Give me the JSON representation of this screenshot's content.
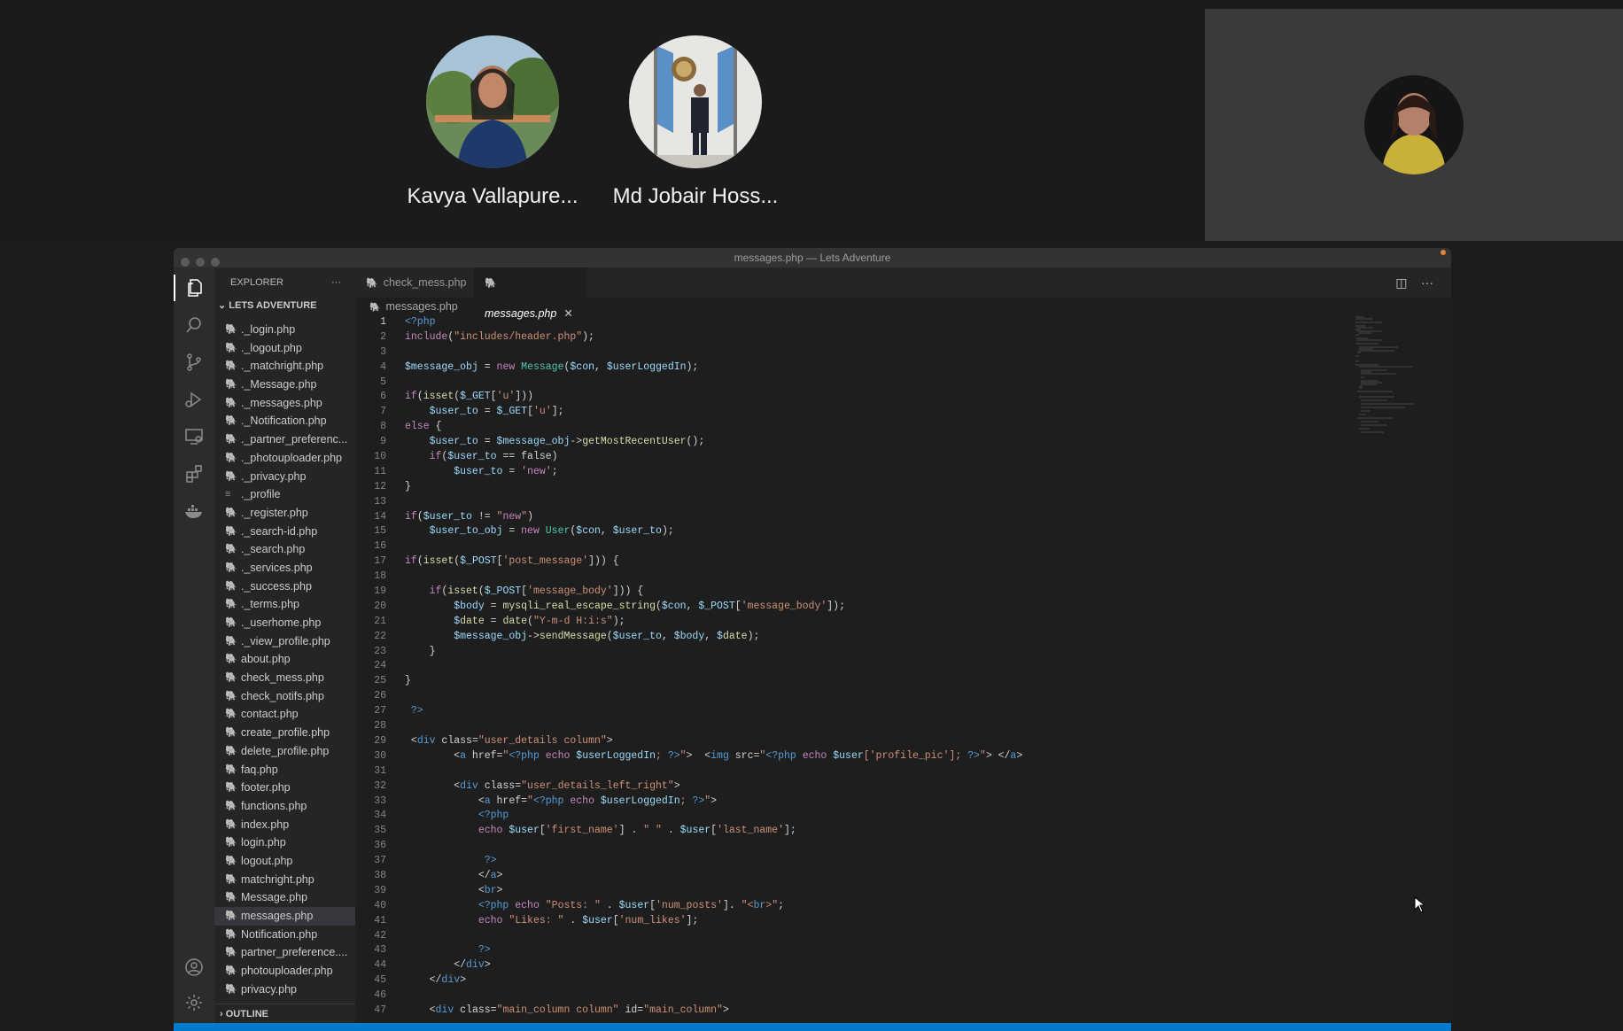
{
  "meeting": {
    "participants": [
      {
        "name": "Kavya Vallapure..."
      },
      {
        "name": "Md Jobair Hoss..."
      }
    ]
  },
  "window": {
    "title": "messages.php — Lets Adventure"
  },
  "sidebar": {
    "title": "EXPLORER",
    "more_label": "···",
    "folder": "LETS ADVENTURE",
    "files": [
      {
        "name": "._login.php",
        "icon": "php-icon"
      },
      {
        "name": "._logout.php",
        "icon": "php-icon"
      },
      {
        "name": "._matchright.php",
        "icon": "php-icon"
      },
      {
        "name": "._Message.php",
        "icon": "php-icon"
      },
      {
        "name": "._messages.php",
        "icon": "php-icon"
      },
      {
        "name": "._Notification.php",
        "icon": "php-icon"
      },
      {
        "name": "._partner_preferenc...",
        "icon": "php-icon"
      },
      {
        "name": "._photouploader.php",
        "icon": "php-icon"
      },
      {
        "name": "._privacy.php",
        "icon": "php-icon"
      },
      {
        "name": "._profile",
        "icon": "file-icon"
      },
      {
        "name": "._register.php",
        "icon": "php-icon"
      },
      {
        "name": "._search-id.php",
        "icon": "php-icon"
      },
      {
        "name": "._search.php",
        "icon": "php-icon"
      },
      {
        "name": "._services.php",
        "icon": "php-icon"
      },
      {
        "name": "._success.php",
        "icon": "php-icon"
      },
      {
        "name": "._terms.php",
        "icon": "php-icon"
      },
      {
        "name": "._userhome.php",
        "icon": "php-icon"
      },
      {
        "name": "._view_profile.php",
        "icon": "php-icon"
      },
      {
        "name": "about.php",
        "icon": "php-icon"
      },
      {
        "name": "check_mess.php",
        "icon": "php-icon"
      },
      {
        "name": "check_notifs.php",
        "icon": "php-icon"
      },
      {
        "name": "contact.php",
        "icon": "php-icon"
      },
      {
        "name": "create_profile.php",
        "icon": "php-icon"
      },
      {
        "name": "delete_profile.php",
        "icon": "php-icon"
      },
      {
        "name": "faq.php",
        "icon": "php-icon"
      },
      {
        "name": "footer.php",
        "icon": "php-icon"
      },
      {
        "name": "functions.php",
        "icon": "php-icon"
      },
      {
        "name": "index.php",
        "icon": "php-icon"
      },
      {
        "name": "login.php",
        "icon": "php-icon"
      },
      {
        "name": "logout.php",
        "icon": "php-icon"
      },
      {
        "name": "matchright.php",
        "icon": "php-icon"
      },
      {
        "name": "Message.php",
        "icon": "php-icon"
      },
      {
        "name": "messages.php",
        "icon": "php-icon",
        "selected": true
      },
      {
        "name": "Notification.php",
        "icon": "php-icon"
      },
      {
        "name": "partner_preference....",
        "icon": "php-icon"
      },
      {
        "name": "photouploader.php",
        "icon": "php-icon"
      },
      {
        "name": "privacy.php",
        "icon": "php-icon"
      }
    ],
    "outline": "OUTLINE"
  },
  "tabs": [
    {
      "label": "check_mess.php",
      "active": false
    },
    {
      "label": "messages.php",
      "active": true
    }
  ],
  "breadcrumb": "messages.php",
  "code": [
    "<?php",
    "include(\"includes/header.php\");",
    "",
    "$message_obj = new Message($con, $userLoggedIn);",
    "",
    "if(isset($_GET['u']))",
    "    $user_to = $_GET['u'];",
    "else {",
    "    $user_to = $message_obj->getMostRecentUser();",
    "    if($user_to == false)",
    "        $user_to = 'new';",
    "}",
    "",
    "if($user_to != \"new\")",
    "    $user_to_obj = new User($con, $user_to);",
    "",
    "if(isset($_POST['post_message'])) {",
    "",
    "    if(isset($_POST['message_body'])) {",
    "        $body = mysqli_real_escape_string($con, $_POST['message_body']);",
    "        $date = date(\"Y-m-d H:i:s\");",
    "        $message_obj->sendMessage($user_to, $body, $date);",
    "    }",
    "",
    "}",
    "",
    " ?>",
    "",
    " <div class=\"user_details column\">",
    "        <a href=\"<?php echo $userLoggedIn; ?>\">  <img src=\"<?php echo $user['profile_pic']; ?>\"> </a>",
    "",
    "        <div class=\"user_details_left_right\">",
    "            <a href=\"<?php echo $userLoggedIn; ?>\">",
    "            <?php",
    "            echo $user['first_name'] . \" \" . $user['last_name'];",
    "",
    "             ?>",
    "            </a>",
    "            <br>",
    "            <?php echo \"Posts: \" . $user['num_posts']. \"<br>\";",
    "            echo \"Likes: \" . $user['num_likes'];",
    "",
    "            ?>",
    "        </div>",
    "    </div>",
    "",
    "    <div class=\"main_column column\" id=\"main_column\">"
  ],
  "colors": {
    "keyword": "#c586c0",
    "variable": "#9cdcfe",
    "string": "#ce9178",
    "function": "#dcdcaa",
    "tag": "#569cd6",
    "class": "#4ec9b0",
    "statusbar": "#007acc"
  }
}
